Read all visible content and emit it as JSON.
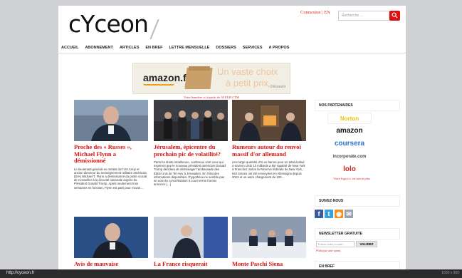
{
  "header": {
    "logo": "cYceon",
    "links": "Connexion | EN",
    "search_placeholder": "Recherche ..."
  },
  "nav": {
    "items": [
      "ACCUEIL",
      "ABONNEMENT",
      "ARTICLES",
      "EN BREF",
      "LETTRE MENSUELLE",
      "DOSSIERS",
      "SERVICES",
      "A PROPOS"
    ]
  },
  "banner": {
    "brand": "amazon.fr",
    "line1": "Un vaste choix",
    "line2": "à petit prix",
    "tag": "› Découvrir",
    "note": "Votre bannière ici à partir de 30 EUR CTM"
  },
  "articles": [
    {
      "title": "Proche des « Russes », Michael Flynn a démissionné",
      "excerpt": "Le lieutenant-général en retraite de l'US Army et ancien directeur du renseignement militaire américain (DIA) Michael T. Flynn a démissionné du poste crucial de Conseiller à la sécurité nationale auprès du Président Donald Trump. Après seulement trois semaines en fonction, Flynn est parti pour n'avoir…"
    },
    {
      "title": "Jérusalem, épicentre du prochain pic de volatilité?",
      "excerpt": "Parmi la droite israélienne, nombreux sont ceux qui espèrent que le nouveau président américain Donald Trump décidera de déménager l'ambassade des Etats-Unis de Tel Aviv à Jérusalem. En l'état des informations disponibles, l'hypothèse ne semble pas en voie de concrétisation à court terme hormis annonce […]"
    },
    {
      "title": "Rumeurs autour du renvoi massif d'or allemand",
      "excerpt": "Une large quantité d'or en barres pour un total évalué à environ USD 13 milliards a été rapatrié de New York à Francfort. Selon la Réserve fédérale de New York, 642 tonnes ont été renvoyées en Allemagne depuis 2013 et un autre chargement de 100…"
    },
    {
      "title": "Avis de mauvaise"
    },
    {
      "title": "La France risquerait"
    },
    {
      "title": "Monte Paschi Siena"
    }
  ],
  "sidebar": {
    "partners_heading": "NOS PARTENAIRES",
    "partners": [
      {
        "name": "Norton",
        "color": "#f2c200"
      },
      {
        "name": "amazon",
        "color": "#111111"
      },
      {
        "name": "coursera",
        "color": "#2a73cc"
      },
      {
        "name": "incorporate.com",
        "color": "#444444"
      },
      {
        "name": "lolo",
        "color": "#c62828"
      }
    ],
    "partners_note": "Votre logo ici, en savoir plus",
    "follow_heading": "SUIVEZ-NOUS",
    "social": [
      {
        "icon": "facebook-icon",
        "glyph": "f",
        "color": "#3b5998"
      },
      {
        "icon": "twitter-icon",
        "glyph": "t",
        "color": "#3aa0dd"
      },
      {
        "icon": "rss-icon",
        "glyph": "◉",
        "color": "#f39024"
      },
      {
        "icon": "mail-icon",
        "glyph": "✉",
        "color": "#9aa3ab"
      }
    ],
    "newsletter_heading": "NEWSLETTER GRATUITE",
    "newsletter_placeholder": "Entrez votre e-mail…",
    "newsletter_button": "VALIDEZ",
    "privacy": "Politique anti-spam.",
    "next_heading": "EN BREF"
  },
  "status": {
    "url": "http://cyceon.fr",
    "resolution": "1600 x 900"
  },
  "colors": {
    "accent": "#d11111",
    "page_bg": "#ffffff",
    "backdrop": "#cfd1d5"
  }
}
